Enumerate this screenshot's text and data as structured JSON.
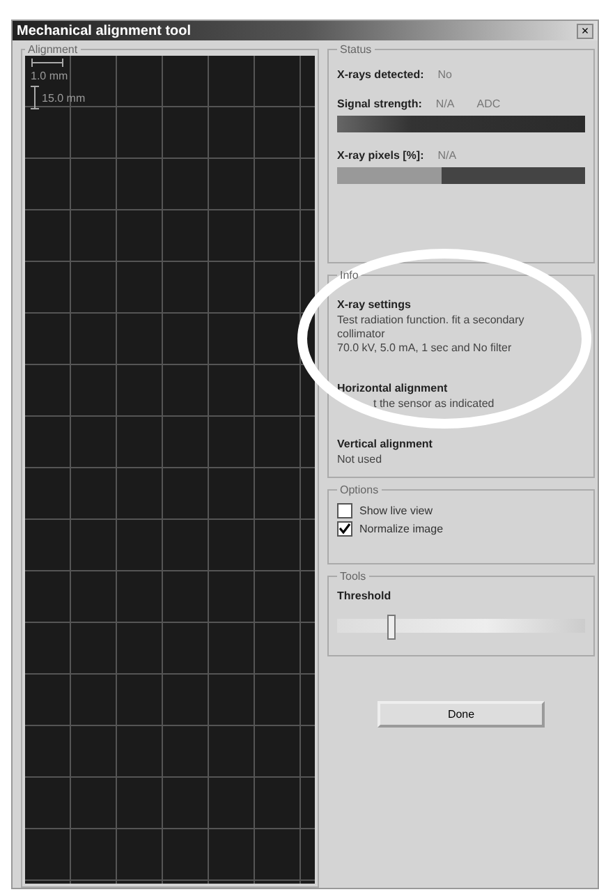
{
  "window": {
    "title": "Mechanical alignment tool",
    "close": "×"
  },
  "alignment": {
    "legend": "Alignment",
    "scale_horizontal": "1.0 mm",
    "scale_vertical": "15.0 mm"
  },
  "status": {
    "legend": "Status",
    "xrays_label": "X-rays detected:",
    "xrays_value": "No",
    "signal_label": "Signal strength:",
    "signal_value": "N/A",
    "signal_unit": "ADC",
    "pixels_label": "X-ray pixels [%]:",
    "pixels_value": "N/A",
    "pixels_bar": {
      "level": 0.42
    }
  },
  "information": {
    "legend": "Info",
    "sections": [
      {
        "heading": "X-ray settings",
        "lines": [
          "Test radiation function. fit a secondary collimator",
          "70.0 kV, 5.0 mA, 1 sec and No filter"
        ]
      },
      {
        "heading": "Horizontal alignment",
        "lines": [
          "t the sensor as indicated"
        ]
      },
      {
        "heading": "Vertical alignment",
        "lines": [
          "Not used"
        ]
      }
    ]
  },
  "options": {
    "legend": "Options",
    "items": [
      {
        "label": "Show live view",
        "checked": false
      },
      {
        "label": "Normalize image",
        "checked": true
      }
    ]
  },
  "tools": {
    "legend": "Tools",
    "threshold_label": "Threshold",
    "threshold": {
      "level": 0.2
    }
  },
  "buttons": [
    "Done"
  ]
}
